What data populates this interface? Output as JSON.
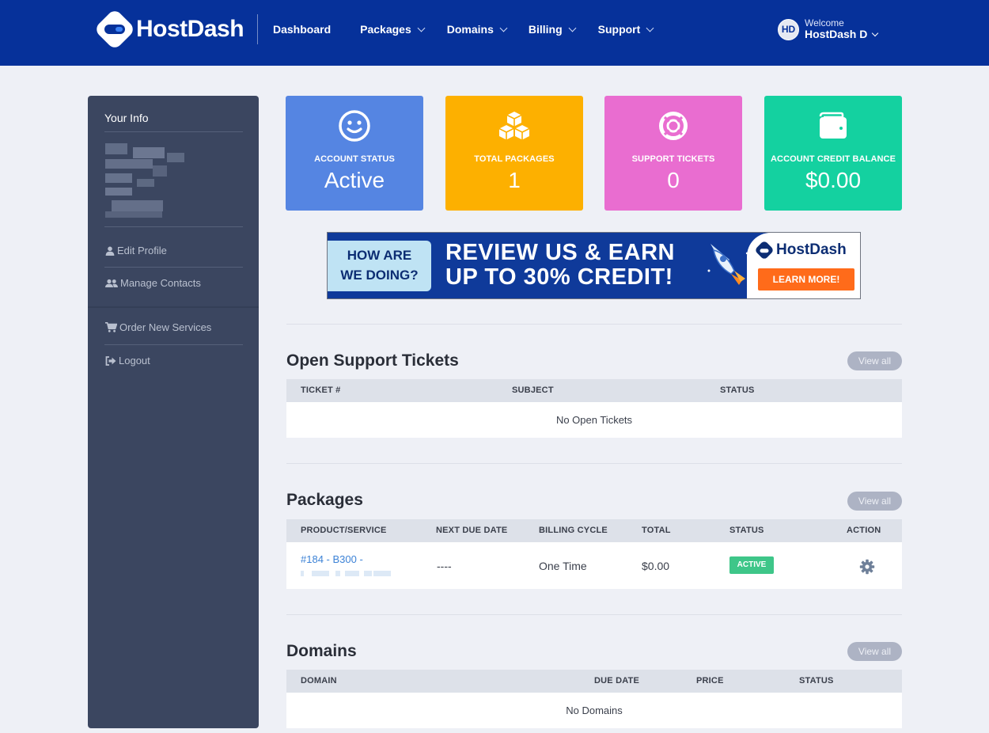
{
  "header": {
    "logo_text": "HostDash",
    "nav": [
      {
        "label": "Dashboard",
        "has_dropdown": false
      },
      {
        "label": "Packages",
        "has_dropdown": true
      },
      {
        "label": "Domains",
        "has_dropdown": true
      },
      {
        "label": "Billing",
        "has_dropdown": true
      },
      {
        "label": "Support",
        "has_dropdown": true
      }
    ],
    "user": {
      "initials": "HD",
      "welcome": "Welcome",
      "name": "HostDash D"
    }
  },
  "sidebar": {
    "title": "Your Info",
    "links": [
      {
        "label": "Edit Profile",
        "icon": "user-icon"
      },
      {
        "label": "Manage Contacts",
        "icon": "users-icon"
      },
      {
        "label": "Order New Services",
        "icon": "cart-icon"
      },
      {
        "label": "Logout",
        "icon": "logout-icon"
      }
    ]
  },
  "stats": [
    {
      "label": "ACCOUNT STATUS",
      "value": "Active",
      "color": "#5585e2",
      "icon": "smile-icon"
    },
    {
      "label": "TOTAL PACKAGES",
      "value": "1",
      "color": "#fdb000",
      "icon": "cubes-icon"
    },
    {
      "label": "SUPPORT TICKETS",
      "value": "0",
      "color": "#e96dd0",
      "icon": "lifering-icon"
    },
    {
      "label": "ACCOUNT CREDIT BALANCE",
      "value": "$0.00",
      "color": "#14d1a0",
      "icon": "wallet-icon"
    }
  ],
  "banner": {
    "left_line1": "HOW ARE",
    "left_line2": "WE DOING?",
    "headline_line1": "REVIEW US & EARN",
    "headline_line2": "UP TO 30% CREDIT!",
    "brand": "HostDash",
    "button": "LEARN MORE!"
  },
  "tickets": {
    "title": "Open Support Tickets",
    "view_all": "View all",
    "columns": [
      "TICKET #",
      "SUBJECT",
      "STATUS"
    ],
    "empty": "No Open Tickets"
  },
  "packages": {
    "title": "Packages",
    "view_all": "View all",
    "columns": [
      "PRODUCT/SERVICE",
      "NEXT DUE DATE",
      "BILLING CYCLE",
      "TOTAL",
      "STATUS",
      "ACTION"
    ],
    "rows": [
      {
        "product": "#184 - B300 -",
        "next_due": "----",
        "cycle": "One Time",
        "total": "$0.00",
        "status": "ACTIVE"
      }
    ]
  },
  "domains": {
    "title": "Domains",
    "view_all": "View all",
    "columns": [
      "DOMAIN",
      "DUE DATE",
      "PRICE",
      "STATUS"
    ],
    "empty": "No Domains"
  }
}
